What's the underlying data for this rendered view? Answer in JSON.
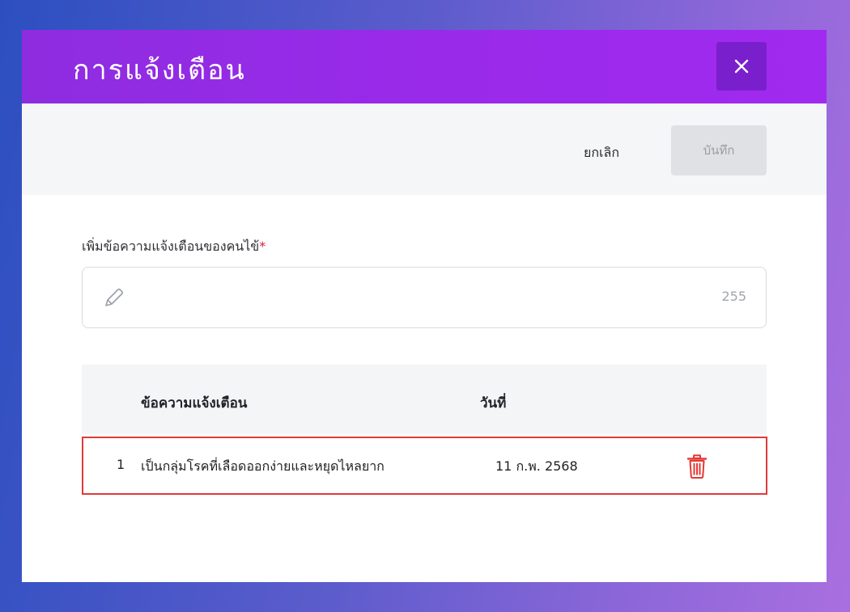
{
  "dialog": {
    "title": "การแจ้งเตือน",
    "close_icon": "close-icon"
  },
  "toolbar": {
    "cancel_label": "ยกเลิก",
    "save_label": "บันทึก"
  },
  "form": {
    "label": "เพิ่มข้อความแจ้งเตือนของคนไข้",
    "required_mark": "*",
    "input_value": "",
    "input_icon": "pencil-icon",
    "char_count": "255"
  },
  "table": {
    "headers": [
      "",
      "ข้อความแจ้งเตือน",
      "วันที่",
      ""
    ],
    "rows": [
      {
        "index": "1",
        "message": "เป็นกลุ่มโรคที่เลือดออกง่ายและหยุดไหลยาก",
        "date": "11 ก.พ. 2568",
        "action_icon": "trash-icon"
      }
    ]
  },
  "colors": {
    "header_purple": "#9b2aeb",
    "close_button": "#7a1fcc",
    "required": "#d91f2a",
    "delete_icon": "#e53935",
    "row_highlight_border": "#e03a3a"
  }
}
